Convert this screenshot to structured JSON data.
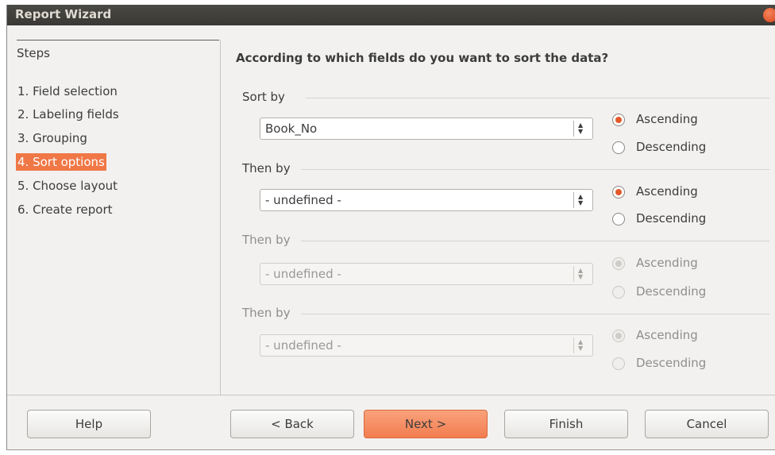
{
  "window": {
    "title": "Report Wizard"
  },
  "steps": {
    "title": "Steps",
    "items": [
      {
        "label": "1. Field selection"
      },
      {
        "label": "2. Labeling fields"
      },
      {
        "label": "3. Grouping"
      },
      {
        "label": "4. Sort options",
        "active": true
      },
      {
        "label": "5. Choose layout"
      },
      {
        "label": "6. Create report"
      }
    ]
  },
  "main": {
    "heading": "According to which fields do you want to sort the data?",
    "sorts": [
      {
        "group_label": "Sort by",
        "field": "Book_No",
        "enabled": true,
        "ascending_label": "Ascending",
        "descending_label": "Descending",
        "selected": "ascending"
      },
      {
        "group_label": "Then by",
        "field": "- undefined -",
        "enabled": true,
        "ascending_label": "Ascending",
        "descending_label": "Descending",
        "selected": "ascending"
      },
      {
        "group_label": "Then by",
        "field": "- undefined -",
        "enabled": false,
        "ascending_label": "Ascending",
        "descending_label": "Descending",
        "selected": "ascending"
      },
      {
        "group_label": "Then by",
        "field": "- undefined -",
        "enabled": false,
        "ascending_label": "Ascending",
        "descending_label": "Descending",
        "selected": "ascending"
      }
    ]
  },
  "buttons": {
    "help": "Help",
    "back": "< Back",
    "next": "Next >",
    "finish": "Finish",
    "cancel": "Cancel"
  },
  "colors": {
    "accent": "#f07746",
    "titlebar": "#3c3b37",
    "background": "#f2f1f0"
  }
}
